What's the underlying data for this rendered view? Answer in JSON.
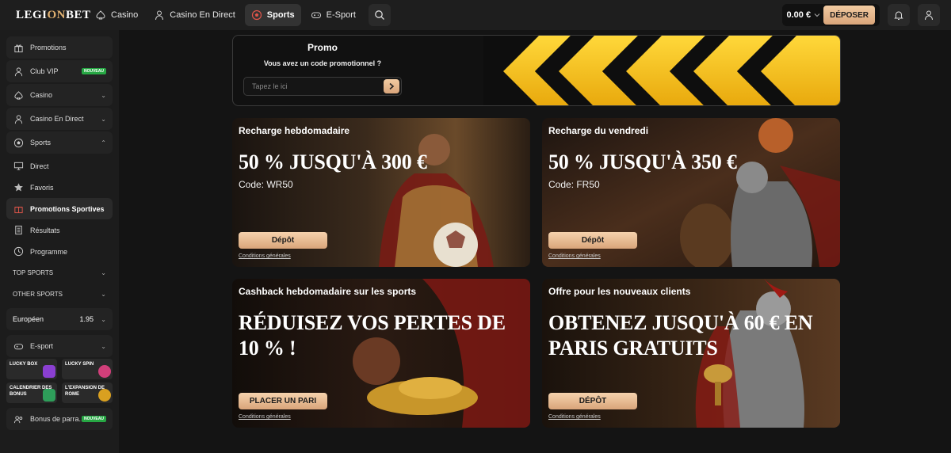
{
  "brand": {
    "logo_a": "LEGI",
    "logo_b": "ON",
    "logo_c": "BET"
  },
  "nav": [
    {
      "label": "Casino",
      "icon": "spade-icon"
    },
    {
      "label": "Casino En Direct",
      "icon": "dealer-icon"
    },
    {
      "label": "Sports",
      "icon": "football-icon",
      "active": true
    },
    {
      "label": "E-Sport",
      "icon": "gamepad-icon"
    }
  ],
  "header": {
    "balance": "0.00 €",
    "deposit_label": "DÉPOSER"
  },
  "sidebar": {
    "top_items": [
      {
        "label": "Promotions",
        "icon": "gift-icon"
      },
      {
        "label": "Club VIP",
        "icon": "user-icon",
        "badge": "NOUVEAU"
      },
      {
        "label": "Casino",
        "icon": "spade-icon"
      },
      {
        "label": "Casino En Direct",
        "icon": "dealer-icon"
      },
      {
        "label": "Sports",
        "icon": "football-icon"
      }
    ],
    "sports_sub": [
      {
        "label": "Direct",
        "icon": "monitor-icon"
      },
      {
        "label": "Favoris",
        "icon": "star-icon"
      },
      {
        "label": "Promotions Sportives",
        "icon": "gift-icon",
        "active": true
      },
      {
        "label": "Résultats",
        "icon": "list-icon"
      },
      {
        "label": "Programme",
        "icon": "clock-icon"
      }
    ],
    "categories": [
      "TOP SPORTS",
      "OTHER SPORTS"
    ],
    "odds_format": {
      "label": "Européen",
      "value": "1.95"
    },
    "esport": {
      "label": "E-sport"
    },
    "games": [
      {
        "label": "LUCKY BOX",
        "color": "#8a3fd1"
      },
      {
        "label": "LUCKY SPIN",
        "color": "#d13f7a"
      },
      {
        "label": "CALENDRIER DES BONUS",
        "color": "#2e9e5a"
      },
      {
        "label": "L'EXPANSION DE ROME",
        "color": "#d9a020"
      }
    ],
    "referral": {
      "label": "Bonus de parra...",
      "badge": "NOUVEAU"
    }
  },
  "promo": {
    "title": "Promo",
    "subtitle": "Vous avez un code promotionnel ?",
    "placeholder": "Tapez le ici"
  },
  "cards": [
    {
      "title": "Recharge hebdomadaire",
      "headline": "50 % JUSQU'À 300 €",
      "code": "Code: WR50",
      "cta": "Dépôt",
      "terms": "Conditions générales"
    },
    {
      "title": "Recharge du vendredi",
      "headline": "50 % JUSQU'À 350 €",
      "code": "Code: FR50",
      "cta": "Dépôt",
      "terms": "Conditions générales"
    },
    {
      "title": "Cashback hebdomadaire sur les sports",
      "headline": "RÉDUISEZ VOS PERTES DE 10 % !",
      "code": "",
      "cta": "PLACER UN PARI",
      "terms": "Conditions générales"
    },
    {
      "title": "Offre pour les nouveaux clients",
      "headline": "OBTENEZ JUSQU'À 60 € EN PARIS GRATUITS",
      "code": "",
      "cta": "DÉPÔT",
      "terms": "Conditions générales"
    }
  ],
  "colors": {
    "accent": "#e0b070",
    "cta_light": "#f2cba2",
    "cta_dark": "#d9a57a",
    "promo_yellow": "#f5c518",
    "badge_green": "#27a844"
  }
}
